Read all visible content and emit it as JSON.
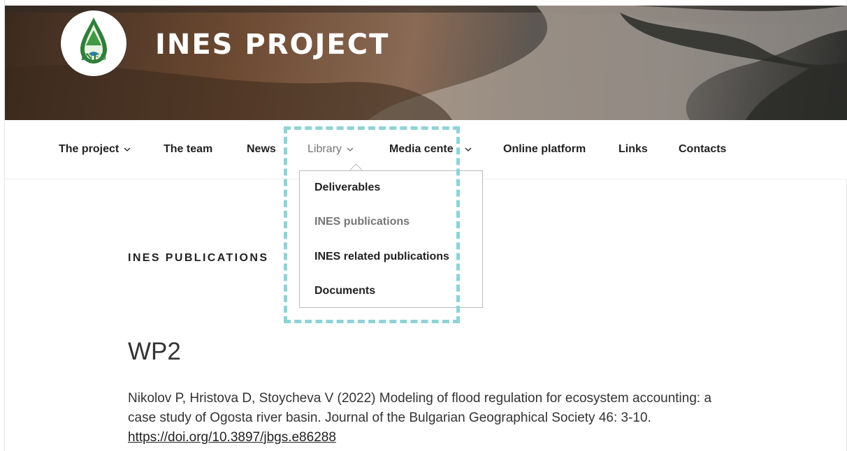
{
  "header": {
    "site_title": "INES PROJECT",
    "logo_text": "INES",
    "logo_colors": {
      "accent": "#3f9a43",
      "water": "#2b7fbf",
      "dark": "#1f4d2a"
    }
  },
  "nav": {
    "items": [
      {
        "label": "The project",
        "has_submenu": true
      },
      {
        "label": "The team",
        "has_submenu": false
      },
      {
        "label": "News",
        "has_submenu": false
      },
      {
        "label": "Library",
        "has_submenu": true,
        "active": true
      },
      {
        "label": "Media cente",
        "has_submenu": true
      },
      {
        "label": "Online platform",
        "has_submenu": false
      },
      {
        "label": "Links",
        "has_submenu": false
      },
      {
        "label": "Contacts",
        "has_submenu": false
      }
    ],
    "chevron_icon": "chevron-down-icon"
  },
  "dropdown": {
    "items": [
      {
        "label": "Deliverables",
        "current": false
      },
      {
        "label": "INES publications",
        "current": true
      },
      {
        "label": "INES related publications",
        "current": false
      },
      {
        "label": "Documents",
        "current": false
      }
    ]
  },
  "content": {
    "page_heading": "INES PUBLICATIONS",
    "section_heading": "WP2",
    "citation": {
      "text": "Nikolov P, Hristova D, Stoycheva V (2022) Modeling of flood regulation for ecosystem accounting: a case study of Ogosta river basin. Journal of the Bulgarian Geographical Society 46: 3-10.",
      "link": "https://doi.org/10.3897/jbgs.e86288"
    }
  },
  "colors": {
    "highlight": "#8fd3d6",
    "text": "#222222",
    "muted": "#767676"
  }
}
